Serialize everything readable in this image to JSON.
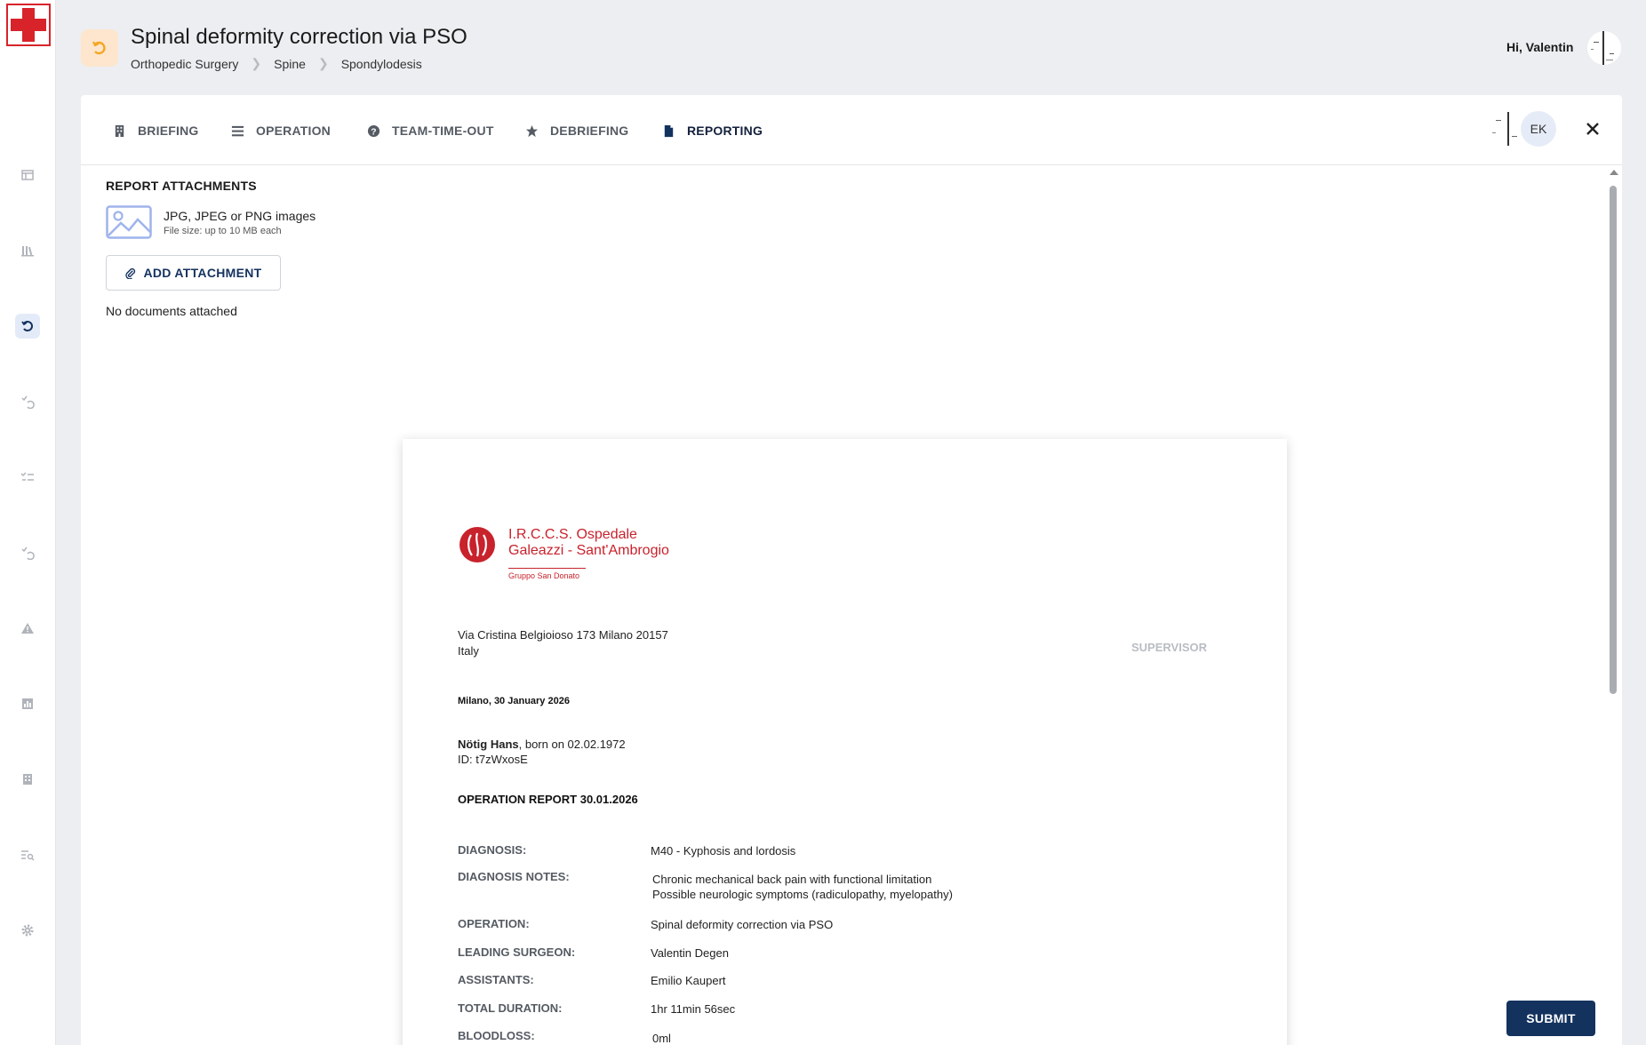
{
  "header": {
    "title": "Spinal deformity correction via PSO",
    "breadcrumb": [
      "Orthopedic Surgery",
      "Spine",
      "Spondylodesis"
    ],
    "greeting": "Hi, Valentin",
    "badge_icon": "undo-arrow-icon",
    "badge_color": "#f5a623"
  },
  "tabs": [
    {
      "label": "BRIEFING",
      "icon": "building-icon"
    },
    {
      "label": "OPERATION",
      "icon": "list-icon"
    },
    {
      "label": "TEAM-TIME-OUT",
      "icon": "question-circle-icon"
    },
    {
      "label": "DEBRIEFING",
      "icon": "star-icon"
    },
    {
      "label": "REPORTING",
      "icon": "document-icon",
      "active": true
    }
  ],
  "team": {
    "initials": "EK"
  },
  "attachments": {
    "title": "REPORT ATTACHMENTS",
    "file_types": "JPG, JPEG or PNG images",
    "file_size": "File size: up to 10 MB each",
    "add_label": "ADD ATTACHMENT",
    "empty_text": "No documents attached"
  },
  "report": {
    "hospital_line1": "I.R.C.C.S. Ospedale",
    "hospital_line2": "Galeazzi - Sant'Ambrogio",
    "hospital_group": "Gruppo San Donato",
    "address_line1": "Via Cristina Belgioioso 173 Milano 20157",
    "address_line2": "Italy",
    "supervisor": "SUPERVISOR",
    "date_line": "Milano, 30 January 2026",
    "patient_name": "Nötig Hans",
    "patient_born": ", born on 02.02.1972",
    "patient_id": "ID: t7zWxosE",
    "report_title": "OPERATION REPORT 30.01.2026",
    "rows": [
      {
        "label": "DIAGNOSIS:",
        "value": "M40 - Kyphosis and lordosis"
      },
      {
        "label": "DIAGNOSIS NOTES:",
        "value": "Chronic mechanical back pain with functional limitation",
        "value2": "Possible neurologic symptoms (radiculopathy, myelopathy)"
      },
      {
        "label": "OPERATION:",
        "value": "Spinal deformity correction via PSO"
      },
      {
        "label": "LEADING SURGEON:",
        "value": "Valentin Degen"
      },
      {
        "label": "ASSISTANTS:",
        "value": "Emilio Kaupert"
      },
      {
        "label": "TOTAL DURATION:",
        "value": "1hr 11min 56sec"
      },
      {
        "label": "BLOODLOSS:",
        "value": "0ml"
      }
    ]
  },
  "actions": {
    "submit_label": "SUBMIT"
  },
  "colors": {
    "primary": "#14325e",
    "accent_red": "#c8222c",
    "orange": "#f5a623"
  }
}
